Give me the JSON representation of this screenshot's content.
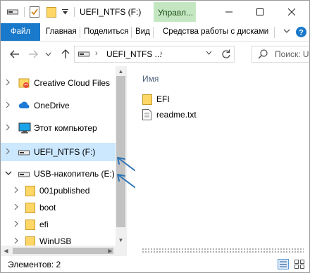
{
  "titlebar": {
    "title": "UEFI_NTFS (F:)",
    "context_tab": "Управл...",
    "window_buttons": [
      "minimize-icon",
      "maximize-icon",
      "close-icon"
    ]
  },
  "ribbon": {
    "tabs": [
      "Файл",
      "Главная",
      "Поделиться",
      "Вид",
      "Средства работы с дисками"
    ],
    "active_tab_color": "#1979ca"
  },
  "address": {
    "path": "UEFI_NTFS ...",
    "search_placeholder": "Поиск: U"
  },
  "nav_pane": {
    "items": [
      {
        "label": "Creative Cloud Files",
        "icon": "creative-cloud-folder-icon",
        "expanded": false
      },
      {
        "label": "OneDrive",
        "icon": "onedrive-cloud-icon",
        "expanded": false
      },
      {
        "label": "Этот компьютер",
        "icon": "computer-icon",
        "expanded": false
      },
      {
        "label": "UEFI_NTFS (F:)",
        "icon": "drive-icon",
        "expanded": false,
        "selected": true
      },
      {
        "label": "USB-накопитель (E:)",
        "icon": "usb-drive-icon",
        "expanded": true
      }
    ],
    "subitems": [
      {
        "label": "001published",
        "icon": "folder-icon"
      },
      {
        "label": "boot",
        "icon": "folder-icon"
      },
      {
        "label": "efi",
        "icon": "folder-icon"
      },
      {
        "label": "WinUSB",
        "icon": "folder-icon"
      }
    ],
    "selected_color": "#cce8ff"
  },
  "content": {
    "column_header": "Имя",
    "files": [
      {
        "name": "EFI",
        "icon": "folder-icon"
      },
      {
        "name": "readme.txt",
        "icon": "text-file-icon"
      }
    ]
  },
  "status": {
    "text": "Элементов: 2"
  },
  "annotation": {
    "arrow_color": "#2e75b6"
  }
}
